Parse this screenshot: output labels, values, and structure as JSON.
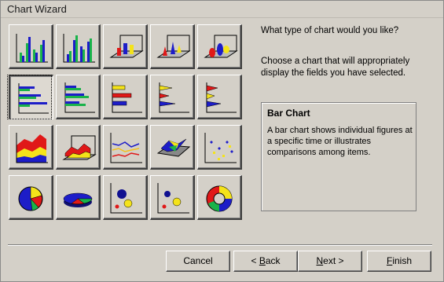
{
  "window": {
    "title": "Chart Wizard"
  },
  "prompt": "What type of chart would you like?",
  "description": "Choose a chart that will appropriately display the fields you have selected.",
  "info": {
    "title": "Bar Chart",
    "text": "A bar chart shows individual figures at a specific time or illustrates comparisons among items."
  },
  "chart_types": [
    {
      "name": "column-chart",
      "icon": "column-icon"
    },
    {
      "name": "stacked-column-chart",
      "icon": "stacked-column-icon"
    },
    {
      "name": "3d-column-chart",
      "icon": "3d-column-icon"
    },
    {
      "name": "3d-cone-chart",
      "icon": "3d-cone-icon"
    },
    {
      "name": "3d-pyramid-chart",
      "icon": "3d-pyramid-icon"
    },
    {
      "name": "bar-chart",
      "icon": "bar-icon",
      "selected": true
    },
    {
      "name": "stacked-bar-chart",
      "icon": "stacked-bar-icon"
    },
    {
      "name": "100-percent-bar-chart",
      "icon": "percent-bar-icon"
    },
    {
      "name": "cone-bar-chart",
      "icon": "cone-bar-icon"
    },
    {
      "name": "pyramid-bar-chart",
      "icon": "pyramid-bar-icon"
    },
    {
      "name": "area-chart",
      "icon": "area-icon"
    },
    {
      "name": "3d-area-chart",
      "icon": "3d-area-icon"
    },
    {
      "name": "line-chart",
      "icon": "line-icon"
    },
    {
      "name": "3d-surface-chart",
      "icon": "surface-icon"
    },
    {
      "name": "scatter-chart",
      "icon": "scatter-icon"
    },
    {
      "name": "pie-chart",
      "icon": "pie-icon"
    },
    {
      "name": "3d-pie-chart",
      "icon": "3d-pie-icon"
    },
    {
      "name": "bubble-chart",
      "icon": "bubble-icon"
    },
    {
      "name": "3d-bubble-chart",
      "icon": "3d-bubble-icon"
    },
    {
      "name": "doughnut-chart",
      "icon": "doughnut-icon"
    }
  ],
  "buttons": {
    "cancel": "Cancel",
    "back_mnemonic": "B",
    "back_rest": "ack",
    "back_prefix": "< ",
    "next_mnemonic": "N",
    "next_rest": "ext >",
    "finish_mnemonic": "F",
    "finish_rest": "inish"
  },
  "colors": {
    "background": "#d4d0c8",
    "blue": "#1d1dc8",
    "green": "#19b34a",
    "red": "#e01818",
    "yellow": "#f4e31a"
  }
}
